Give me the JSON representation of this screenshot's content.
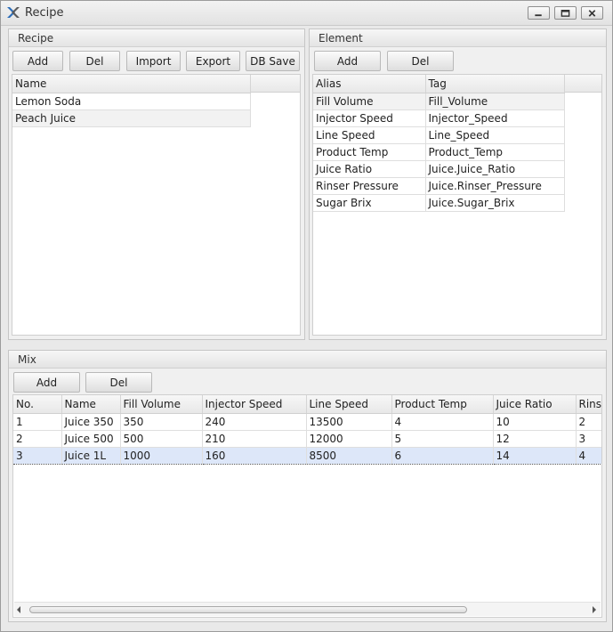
{
  "window": {
    "title": "Recipe"
  },
  "recipe": {
    "header": "Recipe",
    "buttons": {
      "add": "Add",
      "del": "Del",
      "import": "Import",
      "export": "Export",
      "db_save": "DB Save"
    },
    "columns": [
      "Name"
    ],
    "rows": [
      "Lemon Soda",
      "Peach Juice"
    ]
  },
  "element": {
    "header": "Element",
    "buttons": {
      "add": "Add",
      "del": "Del"
    },
    "columns": [
      "Alias",
      "Tag"
    ],
    "rows": [
      [
        "Fill Volume",
        "Fill_Volume"
      ],
      [
        "Injector Speed",
        "Injector_Speed"
      ],
      [
        "Line Speed",
        "Line_Speed"
      ],
      [
        "Product Temp",
        "Product_Temp"
      ],
      [
        "Juice Ratio",
        "Juice.Juice_Ratio"
      ],
      [
        "Rinser Pressure",
        "Juice.Rinser_Pressure"
      ],
      [
        "Sugar Brix",
        "Juice.Sugar_Brix"
      ]
    ]
  },
  "mix": {
    "header": "Mix",
    "buttons": {
      "add": "Add",
      "del": "Del"
    },
    "columns": [
      "No.",
      "Name",
      "Fill Volume",
      "Injector Speed",
      "Line Speed",
      "Product Temp",
      "Juice Ratio",
      "Rinse"
    ],
    "rows": [
      [
        "1",
        "Juice 350",
        "350",
        "240",
        "13500",
        "4",
        "10",
        "2"
      ],
      [
        "2",
        "Juice 500",
        "500",
        "210",
        "12000",
        "5",
        "12",
        "3"
      ],
      [
        "3",
        "Juice 1L",
        "1000",
        "160",
        "8500",
        "6",
        "14",
        "4"
      ]
    ],
    "selected_row": 3
  }
}
